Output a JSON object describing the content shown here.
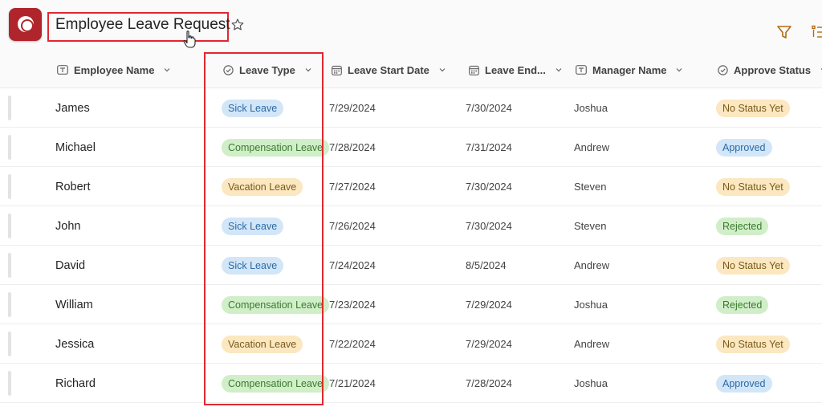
{
  "app": {
    "title": "Employee Leave Request",
    "brand_color": "#b0242c",
    "highlight_color": "#e0282e"
  },
  "columns": [
    {
      "label": "Employee Name",
      "icon": "text-field-icon"
    },
    {
      "label": "Leave Type",
      "icon": "choice-icon"
    },
    {
      "label": "Leave Start Date",
      "icon": "calendar-icon"
    },
    {
      "label": "Leave End...",
      "icon": "calendar-icon"
    },
    {
      "label": "Manager Name",
      "icon": "text-field-icon"
    },
    {
      "label": "Approve Status",
      "icon": "choice-icon"
    }
  ],
  "pill_colors": {
    "Sick Leave": {
      "bg": "#d2e6f8",
      "fg": "#2d6aa6"
    },
    "Compensation Leave": {
      "bg": "#d0eec8",
      "fg": "#3b7a2f"
    },
    "Vacation Leave": {
      "bg": "#fbe7c0",
      "fg": "#7a5a1a"
    },
    "No Status Yet": {
      "bg": "#fbe7c0",
      "fg": "#7a5a1a"
    },
    "Approved": {
      "bg": "#d2e6f8",
      "fg": "#2d6aa6"
    },
    "Rejected": {
      "bg": "#d0eec8",
      "fg": "#3b7a2f"
    }
  },
  "rows": [
    {
      "name": "James",
      "leave_type": "Sick Leave",
      "start": "7/29/2024",
      "end": "7/30/2024",
      "manager": "Joshua",
      "status": "No Status Yet"
    },
    {
      "name": "Michael",
      "leave_type": "Compensation Leave",
      "start": "7/28/2024",
      "end": "7/31/2024",
      "manager": "Andrew",
      "status": "Approved"
    },
    {
      "name": "Robert",
      "leave_type": "Vacation Leave",
      "start": "7/27/2024",
      "end": "7/30/2024",
      "manager": "Steven",
      "status": "No Status Yet"
    },
    {
      "name": "John",
      "leave_type": "Sick Leave",
      "start": "7/26/2024",
      "end": "7/30/2024",
      "manager": "Steven",
      "status": "Rejected"
    },
    {
      "name": "David",
      "leave_type": "Sick Leave",
      "start": "7/24/2024",
      "end": "8/5/2024",
      "manager": "Andrew",
      "status": "No Status Yet"
    },
    {
      "name": "William",
      "leave_type": "Compensation Leave",
      "start": "7/23/2024",
      "end": "7/29/2024",
      "manager": "Joshua",
      "status": "Rejected"
    },
    {
      "name": "Jessica",
      "leave_type": "Vacation Leave",
      "start": "7/22/2024",
      "end": "7/29/2024",
      "manager": "Andrew",
      "status": "No Status Yet"
    },
    {
      "name": "Richard",
      "leave_type": "Compensation Leave",
      "start": "7/21/2024",
      "end": "7/28/2024",
      "manager": "Joshua",
      "status": "Approved"
    }
  ]
}
